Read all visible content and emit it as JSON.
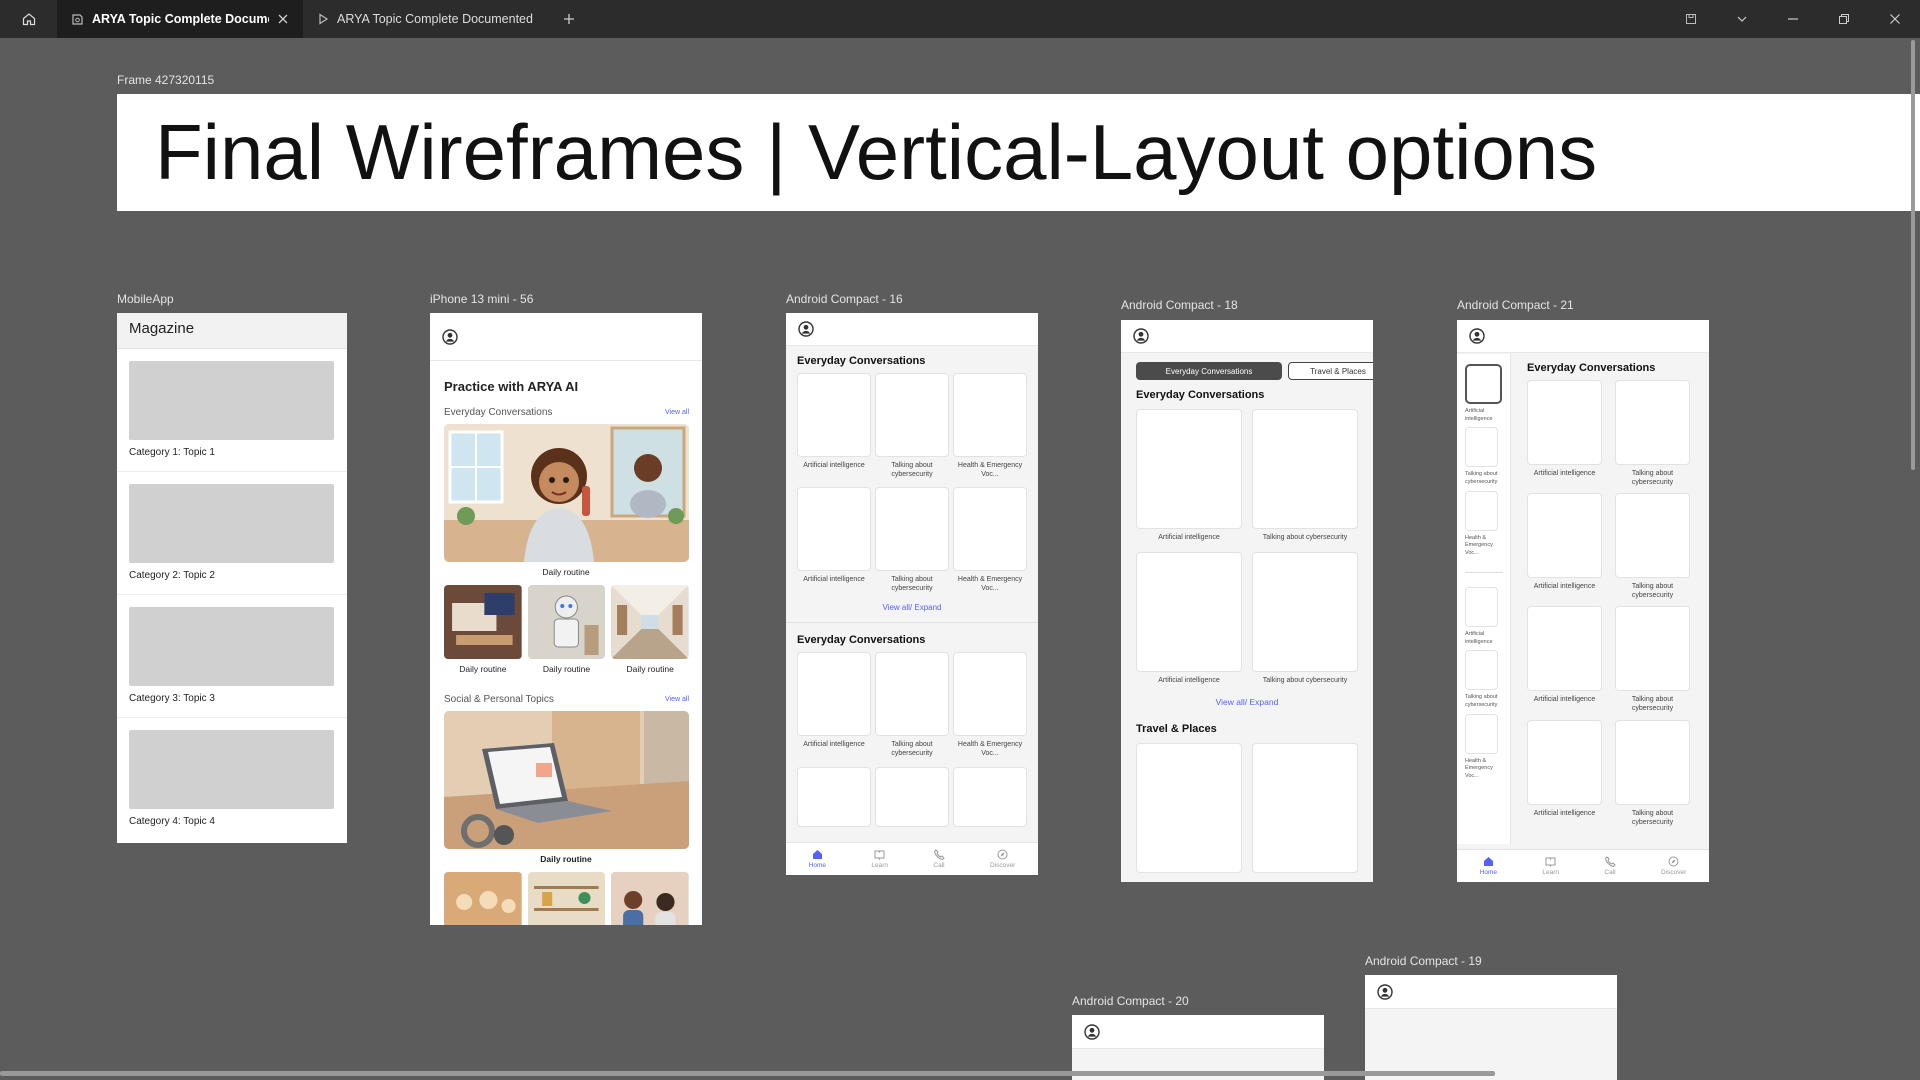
{
  "tabs": [
    {
      "label": "ARYA Topic Complete Document"
    },
    {
      "label": "ARYA Topic Complete Documented Fl"
    }
  ],
  "frame_label": "Frame 427320115",
  "page_title": "Final Wireframes | Vertical-Layout options",
  "mobile_app": {
    "label": "MobileApp",
    "header": "Magazine",
    "items": [
      "Category 1: Topic 1",
      "Category 2: Topic 2",
      "Category 3: Topic 3",
      "Category 4: Topic 4"
    ]
  },
  "iphone": {
    "label": "iPhone 13 mini - 56",
    "title": "Practice with ARYA AI",
    "section1": "Everyday Conversations",
    "section2": "Social & Personal Topics",
    "view_all": "View all",
    "caption": "Daily routine"
  },
  "ac16": {
    "label": "Android Compact - 16",
    "section": "Everyday Conversations",
    "cards": [
      "Artificial intelligence",
      "Talking about cybersecurity",
      "Health & Emergency Voc..."
    ],
    "expand": "View all/ Expand"
  },
  "ac18": {
    "label": "Android Compact - 18",
    "pill1": "Everyday Conversations",
    "pill2": "Travel & Places",
    "section": "Everyday Conversations",
    "section2": "Travel & Places",
    "cards": [
      "Artificial intelligence",
      "Talking about cybersecurity"
    ],
    "expand": "View all/ Expand"
  },
  "ac21": {
    "label": "Android Compact - 21",
    "section": "Everyday Conversations",
    "side": [
      "Artificial intelligence",
      "Talking about cybersecurity",
      "Health & Emergency Voc..."
    ],
    "cards": [
      "Artificial intelligence",
      "Talking about cybersecurity"
    ]
  },
  "ac20": {
    "label": "Android Compact - 20"
  },
  "ac19": {
    "label": "Android Compact - 19"
  },
  "nav": [
    "Home",
    "Learn",
    "Call",
    "Discover"
  ]
}
